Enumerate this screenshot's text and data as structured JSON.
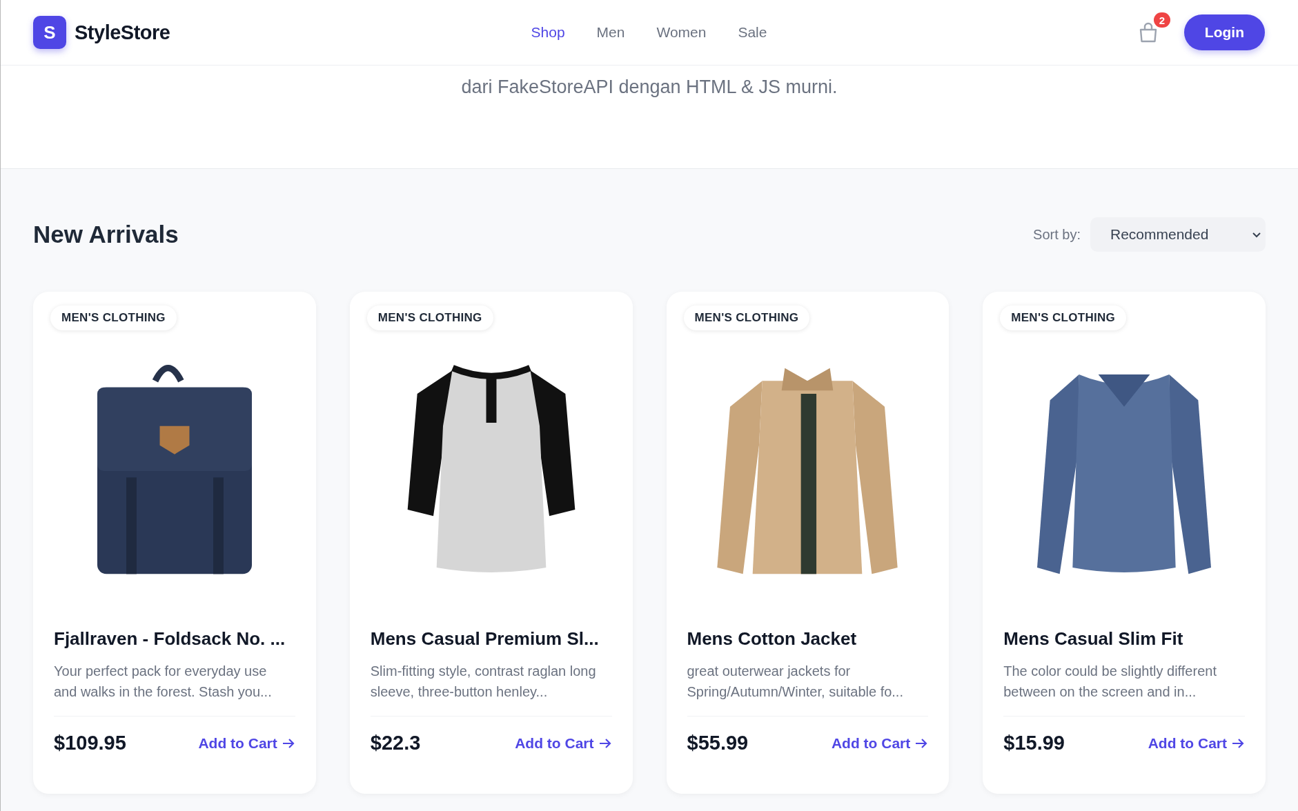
{
  "header": {
    "logo_letter": "S",
    "brand": "StyleStore",
    "nav": [
      {
        "label": "Shop",
        "selected": true
      },
      {
        "label": "Men",
        "selected": false
      },
      {
        "label": "Women",
        "selected": false
      },
      {
        "label": "Sale",
        "selected": false
      }
    ],
    "cart_count": "2",
    "login": "Login"
  },
  "hero": {
    "subtitle": "dari FakeStoreAPI dengan HTML & JS murni."
  },
  "section": {
    "title": "New Arrivals",
    "sort_label": "Sort by:",
    "sort_value": "Recommended"
  },
  "products": [
    {
      "category": "MEN'S CLOTHING",
      "kind": "backpack",
      "title": "Fjallraven - Foldsack No. ...",
      "description": "Your perfect pack for everyday use and walks in the forest. Stash you...",
      "price": "$109.95",
      "action": "Add to Cart"
    },
    {
      "category": "MEN'S CLOTHING",
      "kind": "tshirt",
      "title": "Mens Casual Premium Sl...",
      "description": "Slim-fitting style, contrast raglan long sleeve, three-button henley...",
      "price": "$22.3",
      "action": "Add to Cart"
    },
    {
      "category": "MEN'S CLOTHING",
      "kind": "jacket",
      "title": "Mens Cotton Jacket",
      "description": "great outerwear jackets for Spring/Autumn/Winter, suitable fo...",
      "price": "$55.99",
      "action": "Add to Cart"
    },
    {
      "category": "MEN'S CLOTHING",
      "kind": "sweater",
      "title": "Mens Casual Slim Fit",
      "description": "The color could be slightly different between on the screen and in...",
      "price": "$15.99",
      "action": "Add to Cart"
    }
  ]
}
